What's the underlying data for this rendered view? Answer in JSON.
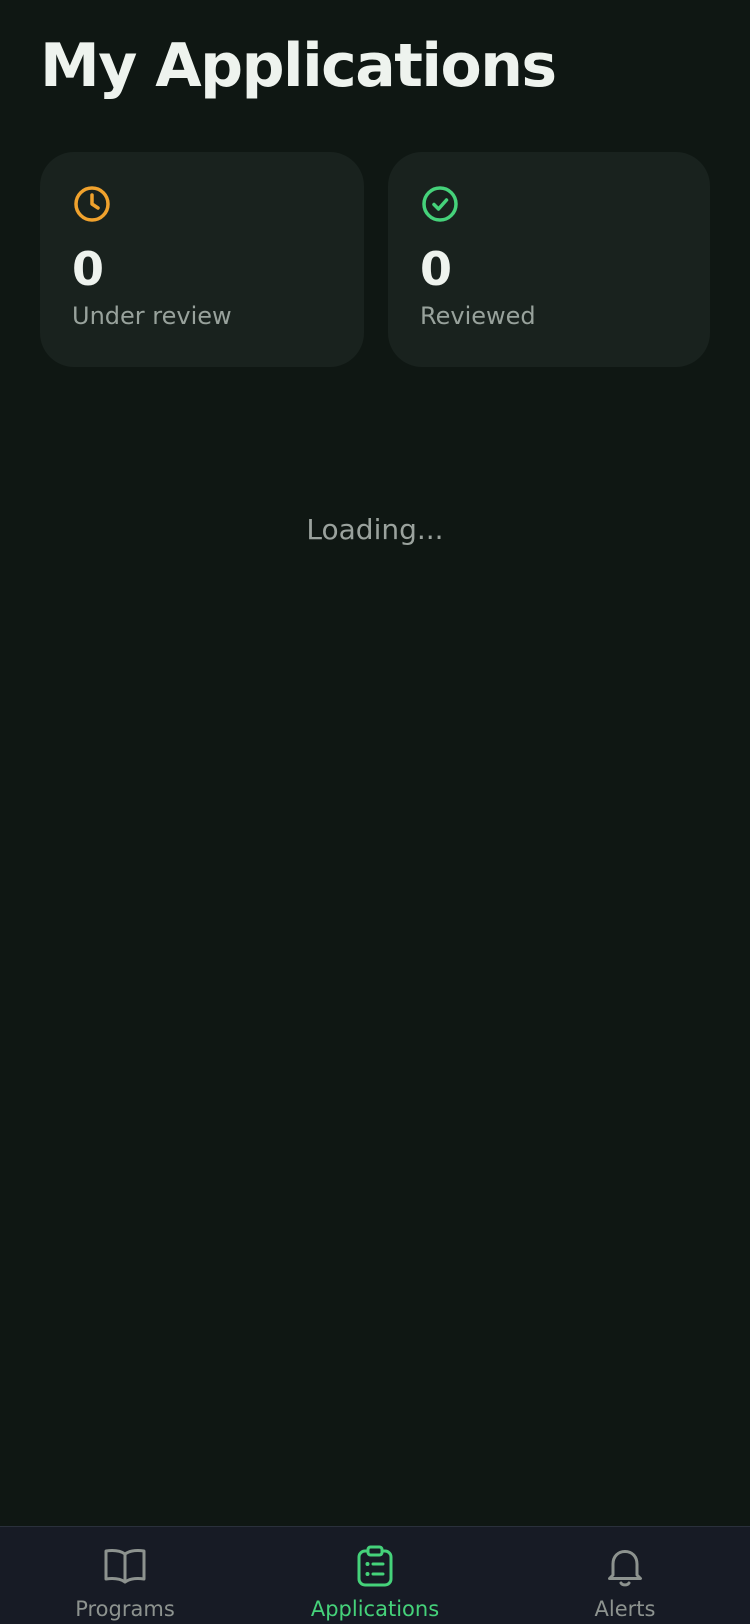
{
  "header": {
    "title": "My Applications"
  },
  "stats": {
    "under_review": {
      "value": "0",
      "label": "Under review",
      "icon": "clock-icon",
      "color": "#f0a22d"
    },
    "reviewed": {
      "value": "0",
      "label": "Reviewed",
      "icon": "check-circle-icon",
      "color": "#45d27a"
    }
  },
  "main": {
    "loading_text": "Loading..."
  },
  "nav": {
    "items": [
      {
        "label": "Programs",
        "icon": "book-open-icon",
        "active": false
      },
      {
        "label": "Applications",
        "icon": "clipboard-list-icon",
        "active": true
      },
      {
        "label": "Alerts",
        "icon": "bell-icon",
        "active": false
      }
    ],
    "active_color": "#45d27a",
    "inactive_color": "#8d938f"
  }
}
